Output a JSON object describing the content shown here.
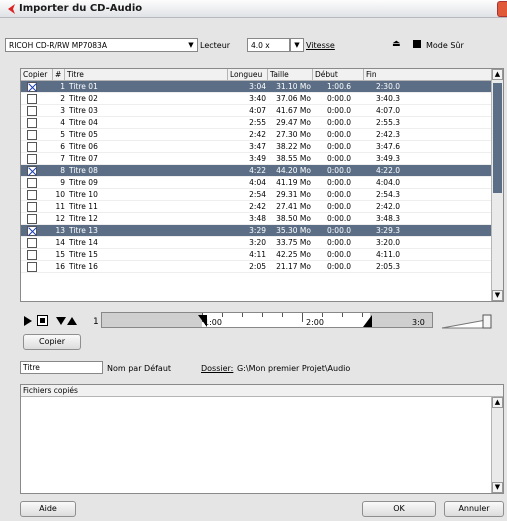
{
  "window": {
    "title": "Importer du CD-Audio"
  },
  "device": {
    "drive": "RICOH   CD-R/RW MP7083A",
    "drive_label": "Lecteur",
    "speed": "4.0 x",
    "speed_label": "Vitesse",
    "safe_mode_label": "Mode Sûr"
  },
  "table": {
    "headers": {
      "copy": "Copier",
      "num": "#",
      "title": "Titre",
      "length": "Longueu",
      "size": "Taille",
      "start": "Début",
      "end": "Fin"
    },
    "rows": [
      {
        "checked": true,
        "num": "1",
        "title": "Titre 01",
        "length": "3:04",
        "size": "31.10 Mo",
        "start": "1:00.6",
        "end": "2:30.0"
      },
      {
        "checked": false,
        "num": "2",
        "title": "Titre 02",
        "length": "3:40",
        "size": "37.06 Mo",
        "start": "0:00.0",
        "end": "3:40.3"
      },
      {
        "checked": false,
        "num": "3",
        "title": "Titre 03",
        "length": "4:07",
        "size": "41.67 Mo",
        "start": "0:00.0",
        "end": "4:07.0"
      },
      {
        "checked": false,
        "num": "4",
        "title": "Titre 04",
        "length": "2:55",
        "size": "29.47 Mo",
        "start": "0:00.0",
        "end": "2:55.3"
      },
      {
        "checked": false,
        "num": "5",
        "title": "Titre 05",
        "length": "2:42",
        "size": "27.30 Mo",
        "start": "0:00.0",
        "end": "2:42.3"
      },
      {
        "checked": false,
        "num": "6",
        "title": "Titre 06",
        "length": "3:47",
        "size": "38.22 Mo",
        "start": "0:00.0",
        "end": "3:47.6"
      },
      {
        "checked": false,
        "num": "7",
        "title": "Titre 07",
        "length": "3:49",
        "size": "38.55 Mo",
        "start": "0:00.0",
        "end": "3:49.3"
      },
      {
        "checked": true,
        "num": "8",
        "title": "Titre 08",
        "length": "4:22",
        "size": "44.20 Mo",
        "start": "0:00.0",
        "end": "4:22.0"
      },
      {
        "checked": false,
        "num": "9",
        "title": "Titre 09",
        "length": "4:04",
        "size": "41.19 Mo",
        "start": "0:00.0",
        "end": "4:04.0"
      },
      {
        "checked": false,
        "num": "10",
        "title": "Titre 10",
        "length": "2:54",
        "size": "29.31 Mo",
        "start": "0:00.0",
        "end": "2:54.3"
      },
      {
        "checked": false,
        "num": "11",
        "title": "Titre 11",
        "length": "2:42",
        "size": "27.41 Mo",
        "start": "0:00.0",
        "end": "2:42.0"
      },
      {
        "checked": false,
        "num": "12",
        "title": "Titre 12",
        "length": "3:48",
        "size": "38.50 Mo",
        "start": "0:00.0",
        "end": "3:48.3"
      },
      {
        "checked": true,
        "num": "13",
        "title": "Titre 13",
        "length": "3:29",
        "size": "35.30 Mo",
        "start": "0:00.0",
        "end": "3:29.3"
      },
      {
        "checked": false,
        "num": "14",
        "title": "Titre 14",
        "length": "3:20",
        "size": "33.75 Mo",
        "start": "0:00.0",
        "end": "3:20.0"
      },
      {
        "checked": false,
        "num": "15",
        "title": "Titre 15",
        "length": "4:11",
        "size": "42.25 Mo",
        "start": "0:00.0",
        "end": "4:11.0"
      },
      {
        "checked": false,
        "num": "16",
        "title": "Titre 16",
        "length": "2:05",
        "size": "21.17 Mo",
        "start": "0:00.0",
        "end": "2:05.3"
      }
    ]
  },
  "ruler": {
    "labels": [
      "1",
      "1:00",
      "2:00",
      "3:0"
    ]
  },
  "copy_button": "Copier",
  "naming": {
    "field_label": "Titre",
    "default_name_label": "Nom par Défaut",
    "folder_label": "Dossier:",
    "folder_path": "G:\\Mon premier Projet\\Audio"
  },
  "copied_files": {
    "header": "Fichiers copiés"
  },
  "footer": {
    "help": "Aide",
    "ok": "OK",
    "cancel": "Annuler"
  },
  "colors": {
    "selection": "#5b6e86",
    "check": "#1d3fb5",
    "close": "#e05a3a"
  }
}
